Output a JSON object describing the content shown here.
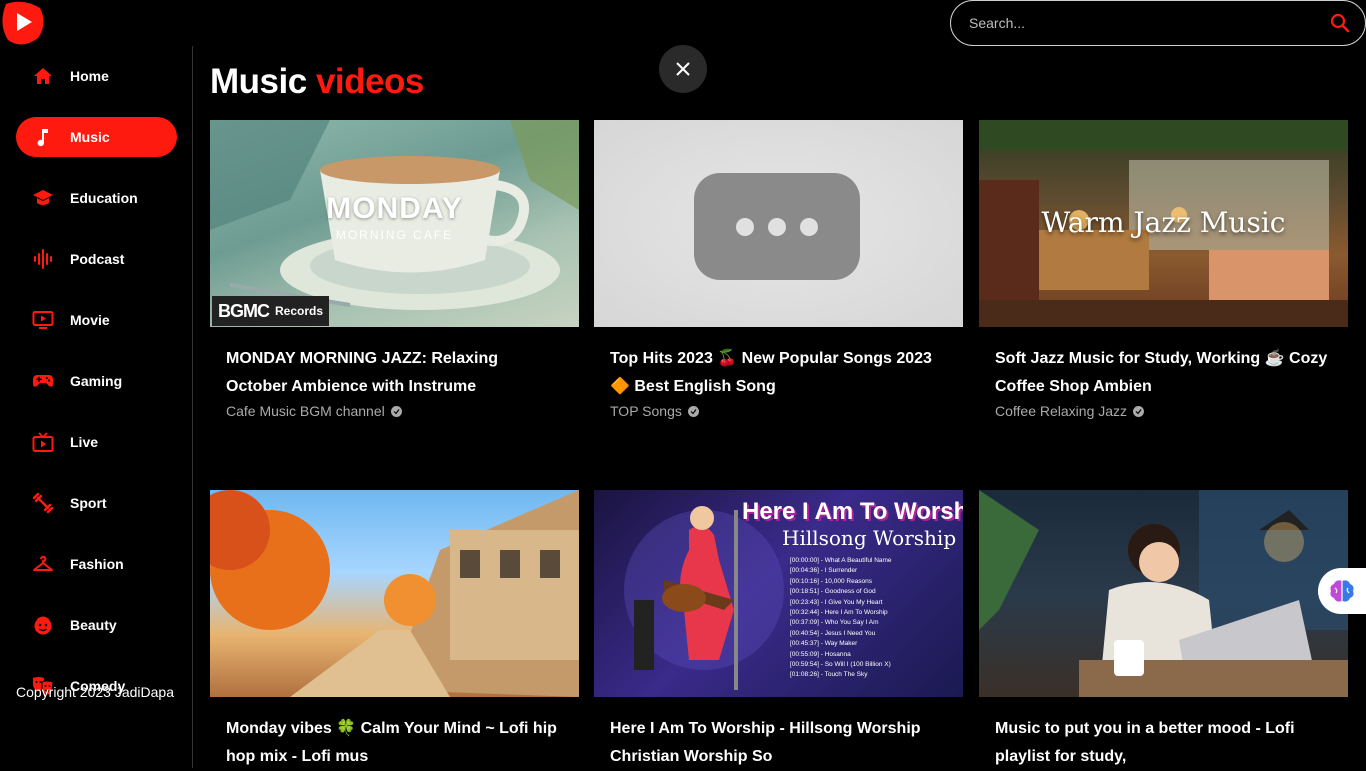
{
  "app": {
    "logo_icon": "play-logo-icon",
    "accent_color": "#ff1a10"
  },
  "search": {
    "placeholder": "Search...",
    "value": "",
    "icon": "search-icon"
  },
  "sidebar": {
    "items": [
      {
        "label": "Home",
        "icon": "home-icon",
        "active": false
      },
      {
        "label": "Music",
        "icon": "music-note-icon",
        "active": true
      },
      {
        "label": "Education",
        "icon": "graduation-cap-icon",
        "active": false
      },
      {
        "label": "Podcast",
        "icon": "audio-wave-icon",
        "active": false
      },
      {
        "label": "Movie",
        "icon": "tv-play-icon",
        "active": false
      },
      {
        "label": "Gaming",
        "icon": "gamepad-icon",
        "active": false
      },
      {
        "label": "Live",
        "icon": "live-tv-icon",
        "active": false
      },
      {
        "label": "Sport",
        "icon": "dumbbell-icon",
        "active": false
      },
      {
        "label": "Fashion",
        "icon": "hanger-icon",
        "active": false
      },
      {
        "label": "Beauty",
        "icon": "face-icon",
        "active": false
      },
      {
        "label": "Comedy",
        "icon": "theater-masks-icon",
        "active": false
      }
    ],
    "copyright": "Copyright 2023 JadiDapa"
  },
  "main": {
    "title_prefix": "Music",
    "title_accent": "videos",
    "close_icon": "close-icon",
    "videos": [
      {
        "title": "MONDAY MORNING JAZZ: Relaxing October Ambience with Instrume",
        "channel": "Cafe Music BGM channel",
        "thumb_heading": "MONDAY",
        "thumb_sub": "MORNING CAFE",
        "thumb_badge_a": "BGMC",
        "thumb_badge_b": "Records"
      },
      {
        "title": "Top Hits 2023 🍒 New Popular Songs 2023 🔶 Best English Song",
        "channel": "TOP Songs"
      },
      {
        "title": "Soft Jazz Music for Study, Working ☕ Cozy Coffee Shop Ambien",
        "channel": "Coffee Relaxing Jazz",
        "thumb_heading": "Warm Jazz Music"
      },
      {
        "title": "Monday vibes 🍀 Calm Your Mind ~ Lofi hip hop mix - Lofi mus",
        "channel": ""
      },
      {
        "title": "Here I Am To Worship - Hillsong Worship Christian Worship So",
        "channel": "",
        "thumb_heading": "Here I Am To Worship",
        "thumb_sub": "Hillsong Worship",
        "tracklist": [
          "[00:00:00] - What A Beautiful Name",
          "[00:04:36] - I Surrender",
          "[00:10:16] - 10,000 Reasons",
          "[00:18:51] - Goodness of God",
          "[00:23:43] - I Give You My Heart",
          "[00:32:44] - Here I Am To Worship",
          "[00:37:09] - Who You Say I Am",
          "[00:40:54] - Jesus I Need You",
          "[00:45:37] - Way Maker",
          "[00:55:09] - Hosanna",
          "[00:59:54] - So Will I (100 Billion X)",
          "[01:08:26] - Touch The Sky"
        ]
      },
      {
        "title": "Music to put you in a better mood - Lofi playlist for study,",
        "channel": ""
      }
    ]
  },
  "floating": {
    "brain_icon": "brain-icon"
  }
}
